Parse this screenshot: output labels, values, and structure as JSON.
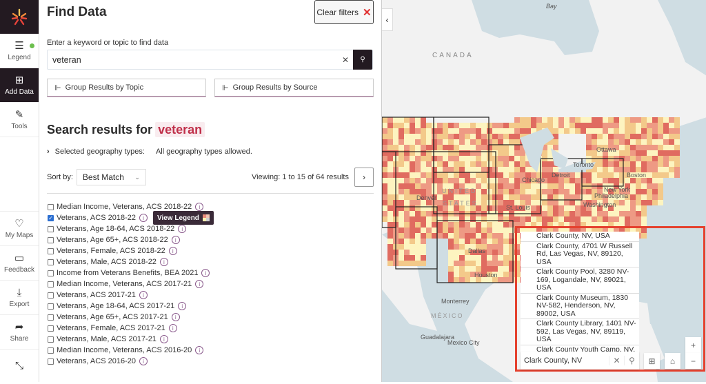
{
  "rail": {
    "items": [
      {
        "label": "Legend",
        "icon": "list-icon"
      },
      {
        "label": "Add Data",
        "icon": "add-file-icon"
      },
      {
        "label": "Tools",
        "icon": "tools-icon"
      },
      {
        "label": "My Maps",
        "icon": "heart-icon"
      },
      {
        "label": "Feedback",
        "icon": "feedback-icon"
      },
      {
        "label": "Export",
        "icon": "download-icon"
      },
      {
        "label": "Share",
        "icon": "share-icon"
      }
    ]
  },
  "panel": {
    "title": "Find Data",
    "clear_filters": "Clear filters",
    "search_label": "Enter a keyword or topic to find data",
    "search_value": "veteran",
    "group_topic": "Group Results by Topic",
    "group_source": "Group Results by Source",
    "results_heading": "Search results for",
    "results_term": "veteran",
    "geo_label": "Selected geography types:",
    "geo_value": "All geography types allowed.",
    "sort_label": "Sort by:",
    "sort_value": "Best Match",
    "viewing": "Viewing: 1 to 15 of 64 results",
    "view_legend": "View Legend",
    "results": [
      {
        "label": "Median Income, Veterans, ACS 2018-22",
        "checked": false
      },
      {
        "label": "Veterans, ACS 2018-22",
        "checked": true
      },
      {
        "label": "Veterans, Age 18-64, ACS 2018-22",
        "checked": false
      },
      {
        "label": "Veterans, Age 65+, ACS 2018-22",
        "checked": false
      },
      {
        "label": "Veterans, Female, ACS 2018-22",
        "checked": false
      },
      {
        "label": "Veterans, Male, ACS 2018-22",
        "checked": false
      },
      {
        "label": "Income from Veterans Benefits, BEA 2021",
        "checked": false
      },
      {
        "label": "Median Income, Veterans, ACS 2017-21",
        "checked": false
      },
      {
        "label": "Veterans, ACS 2017-21",
        "checked": false
      },
      {
        "label": "Veterans, Age 18-64, ACS 2017-21",
        "checked": false
      },
      {
        "label": "Veterans, Age 65+, ACS 2017-21",
        "checked": false
      },
      {
        "label": "Veterans, Female, ACS 2017-21",
        "checked": false
      },
      {
        "label": "Veterans, Male, ACS 2017-21",
        "checked": false
      },
      {
        "label": "Median Income, Veterans, ACS 2016-20",
        "checked": false
      },
      {
        "label": "Veterans, ACS 2016-20",
        "checked": false
      }
    ]
  },
  "map": {
    "labels": [
      "Bay",
      "CANADA",
      "Ottawa",
      "Toronto",
      "Chicago",
      "Detroit",
      "Boston",
      "New York",
      "Philadelphia",
      "Washington",
      "Denver",
      "UNITED",
      "STATES",
      "St. Louis",
      "Dallas",
      "Houston",
      "Monterrey",
      "MÉXICO",
      "Guadalajara",
      "Mexico City"
    ],
    "geosearch_value": "Clark County, NV",
    "suggestions": [
      "Clark County, NV, USA",
      "Clark County, 4701 W Russell Rd, Las Vegas, NV, 89120, USA",
      "Clark County Pool, 3280 NV-169, Logandale, NV, 89021, USA",
      "Clark County Museum, 1830 NV-582, Henderson, NV, 89002, USA",
      "Clark County Library, 1401 NV-592, Las Vegas, NV, 89119, USA",
      "Clark County Youth Camp, NV, USA"
    ],
    "zoom_in": "+",
    "zoom_out": "−"
  },
  "colors": {
    "accent": "#231a21",
    "highlight": "#e5412e",
    "term": "#c0304a",
    "choropleth": [
      "#fdf4c0",
      "#f3c98a",
      "#ee9a84",
      "#e06b60"
    ]
  }
}
